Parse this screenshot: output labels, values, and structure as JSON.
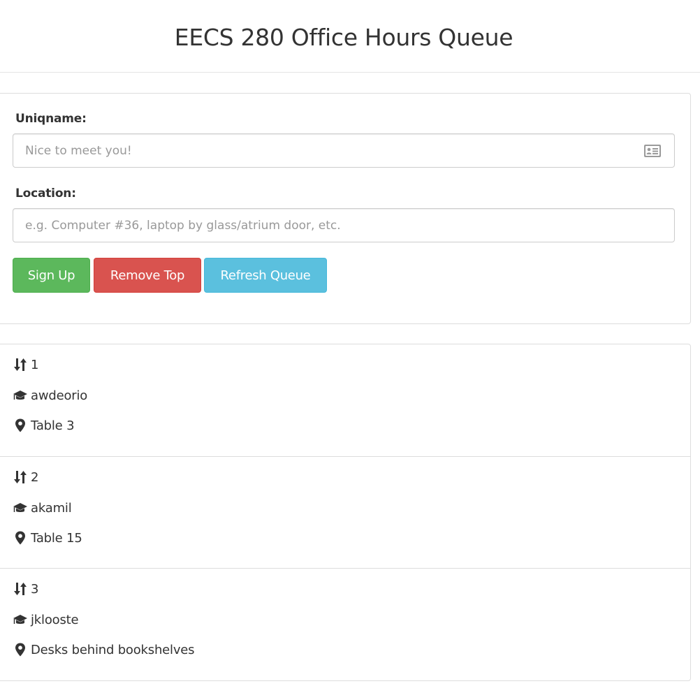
{
  "header": {
    "title": "EECS 280 Office Hours Queue"
  },
  "form": {
    "uniqname_label": "Uniqname:",
    "uniqname_placeholder": "Nice to meet you!",
    "uniqname_value": "",
    "location_label": "Location:",
    "location_placeholder": "e.g. Computer #36, laptop by glass/atrium door, etc.",
    "location_value": "",
    "buttons": {
      "signup": "Sign Up",
      "remove": "Remove Top",
      "refresh": "Refresh Queue"
    },
    "colors": {
      "signup": "#5cb85c",
      "remove": "#d9534f",
      "refresh": "#5bc0de"
    }
  },
  "queue": [
    {
      "position": "1",
      "uniqname": "awdeorio",
      "location": "Table 3"
    },
    {
      "position": "2",
      "uniqname": "akamil",
      "location": "Table 15"
    },
    {
      "position": "3",
      "uniqname": "jklooste",
      "location": "Desks behind bookshelves"
    }
  ],
  "icons": {
    "position": "sort-icon",
    "uniqname": "graduation-cap-icon",
    "location": "map-marker-icon",
    "input": "id-card-icon"
  }
}
